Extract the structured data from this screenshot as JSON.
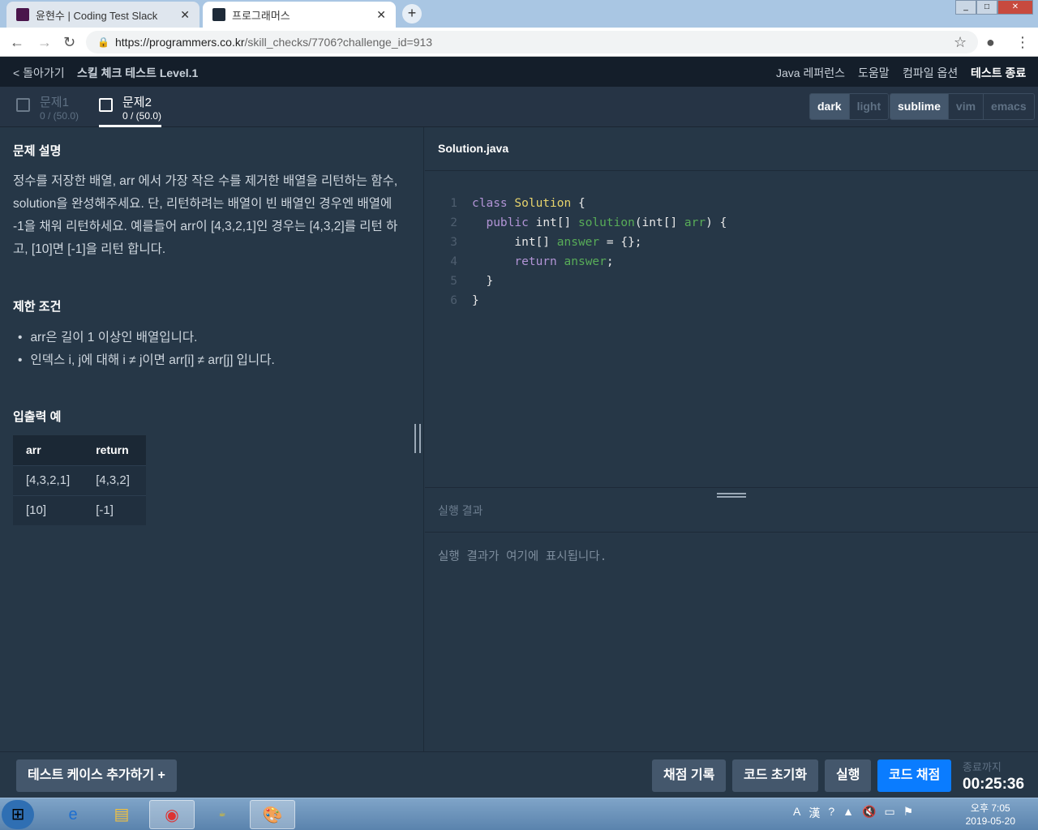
{
  "browser": {
    "tabs": [
      {
        "title": "윤현수 | Coding Test Slack"
      },
      {
        "title": "프로그래머스"
      }
    ],
    "url_host": "https://programmers.co.kr",
    "url_path": "/skill_checks/7706?challenge_id=913"
  },
  "header": {
    "back": "< 돌아가기",
    "title": "스킬 체크 테스트 Level.1",
    "links": [
      "Java 레퍼런스",
      "도움말",
      "컴파일 옵션",
      "테스트 종료"
    ]
  },
  "problems": [
    {
      "label": "문제1",
      "score": "0 / (50.0)"
    },
    {
      "label": "문제2",
      "score": "0 / (50.0)"
    }
  ],
  "themes": [
    "dark",
    "light"
  ],
  "keymaps": [
    "sublime",
    "vim",
    "emacs"
  ],
  "description": {
    "title": "문제 설명",
    "text": "정수를 저장한 배열, arr 에서 가장 작은 수를 제거한 배열을 리턴하는 함수, solution을 완성해주세요. 단, 리턴하려는 배열이 빈 배열인 경우엔 배열에 -1을 채워 리턴하세요. 예를들어 arr이 [4,3,2,1]인 경우는 [4,3,2]를 리턴 하고, [10]면 [-1]을 리턴 합니다.",
    "constraints_title": "제한 조건",
    "constraints": [
      "arr은 길이 1 이상인 배열입니다.",
      "인덱스 i, j에 대해 i ≠ j이면 arr[i] ≠ arr[j] 입니다."
    ],
    "examples_title": "입출력 예",
    "columns": [
      "arr",
      "return"
    ],
    "rows": [
      [
        "[4,3,2,1]",
        "[4,3,2]"
      ],
      [
        "[10]",
        "[-1]"
      ]
    ]
  },
  "editor": {
    "filename": "Solution.java"
  },
  "result": {
    "title": "실행 결과",
    "placeholder": "실행 결과가 여기에 표시됩니다."
  },
  "footer": {
    "add_testcase": "테스트 케이스 추가하기 +",
    "history": "채점 기록",
    "reset": "코드 초기화",
    "run": "실행",
    "submit": "코드 채점",
    "timer_label": "종료까지",
    "timer": "00:25:36"
  },
  "taskbar": {
    "time": "오후 7:05",
    "date": "2019-05-20"
  }
}
